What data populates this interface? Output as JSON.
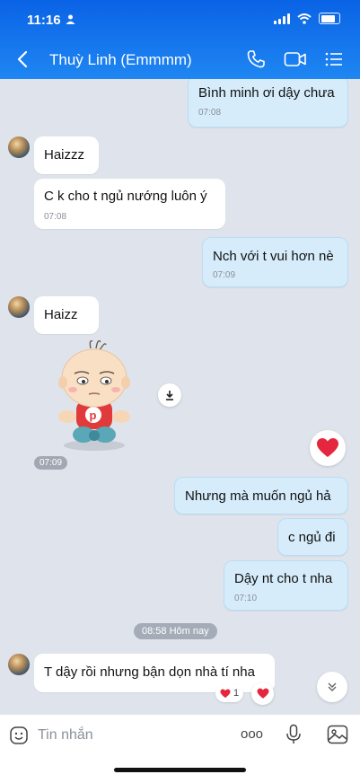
{
  "status": {
    "time": "11:16"
  },
  "header": {
    "contact_name": "Thuỳ Linh (Emmmm)"
  },
  "messages": [
    {
      "dir": "out",
      "text": "Bình minh ơi dậy chưa",
      "time": "07:08"
    },
    {
      "dir": "in",
      "text": "Haizzz",
      "time": ""
    },
    {
      "dir": "in",
      "text": "C k cho t ngủ nướng luôn ý",
      "time": "07:08"
    },
    {
      "dir": "out",
      "text": "Nch với t vui hơn nè",
      "time": "07:09"
    },
    {
      "dir": "in",
      "text": "Haizz",
      "time": ""
    },
    {
      "dir": "in",
      "type": "sticker",
      "time": "07:09"
    },
    {
      "dir": "out",
      "text": "Nhưng mà muốn ngủ hả",
      "time": ""
    },
    {
      "dir": "out",
      "text": "c ngủ đi",
      "time": ""
    },
    {
      "dir": "out",
      "text": "Dậy nt cho t nha",
      "time": "07:10"
    },
    {
      "dir": "in",
      "text": "T dậy rồi nhưng bận dọn nhà tí nha",
      "time": "",
      "reaction_count": "1"
    }
  ],
  "separator": {
    "text": "08:58 Hôm nay"
  },
  "input": {
    "placeholder": "Tin nhắn",
    "more_label": "ooo"
  },
  "icons": [
    "back-icon",
    "phone-icon",
    "video-call-icon",
    "menu-list-icon",
    "download-icon",
    "heart-icon",
    "scroll-down-icon",
    "emoji-icon",
    "microphone-icon",
    "image-icon"
  ],
  "colors": {
    "header": "#0a63e6",
    "outgoing_bubble": "#d6ecfb",
    "heart": "#e5263f"
  }
}
